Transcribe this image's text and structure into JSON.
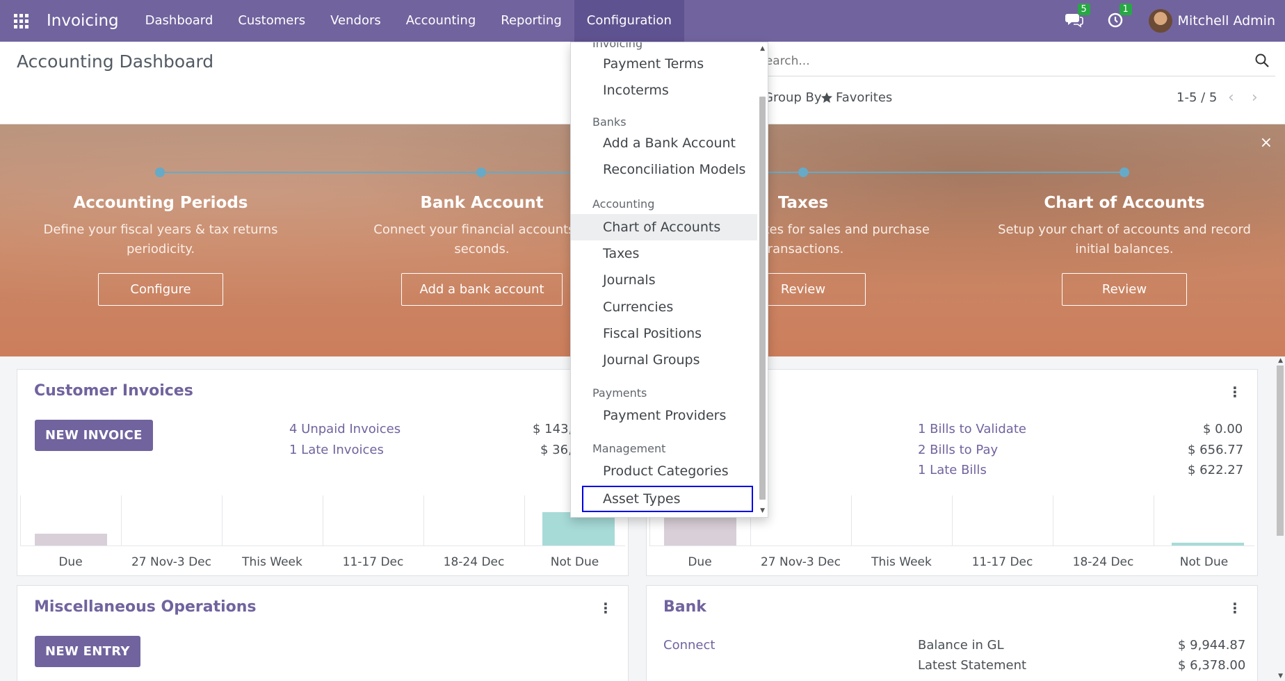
{
  "navbar": {
    "brand": "Invoicing",
    "menu": [
      "Dashboard",
      "Customers",
      "Vendors",
      "Accounting",
      "Reporting",
      "Configuration"
    ],
    "messages_count": "5",
    "activities_count": "1",
    "user_name": "Mitchell Admin"
  },
  "control_panel": {
    "title": "Accounting Dashboard",
    "search_placeholder": "Search...",
    "group_by": "Group By",
    "favorites": "Favorites",
    "pager": "1-5 / 5"
  },
  "onboarding": {
    "steps": [
      {
        "title": "Accounting Periods",
        "desc": "Define your fiscal years & tax returns periodicity.",
        "button": "Configure"
      },
      {
        "title": "Bank Account",
        "desc": "Connect your financial accounts in seconds.",
        "button": "Add a bank account"
      },
      {
        "title": "Taxes",
        "desc": "Set default Taxes for sales and purchase transactions.",
        "button": "Review"
      },
      {
        "title": "Chart of Accounts",
        "desc": "Setup your chart of accounts and record initial balances.",
        "button": "Review"
      }
    ],
    "close": "×"
  },
  "customer_invoices": {
    "title": "Customer Invoices",
    "button": "NEW INVOICE",
    "rows": [
      {
        "label": "4 Unpaid Invoices",
        "amount": "$ 143,"
      },
      {
        "label": "1 Late Invoices",
        "amount": "$ 36,"
      }
    ],
    "graph_labels": [
      "Due",
      "27 Nov-3 Dec",
      "This Week",
      "11-17 Dec",
      "18-24 Dec",
      "Not Due"
    ]
  },
  "vendor_bills": {
    "rows": [
      {
        "label": "1 Bills to Validate",
        "amount": "$ 0.00"
      },
      {
        "label": "2 Bills to Pay",
        "amount": "$ 656.77"
      },
      {
        "label": "1 Late Bills",
        "amount": "$ 622.27"
      }
    ],
    "graph_labels": [
      "Due",
      "27 Nov-3 Dec",
      "This Week",
      "11-17 Dec",
      "18-24 Dec",
      "Not Due"
    ]
  },
  "misc_operations": {
    "title": "Miscellaneous Operations",
    "button": "NEW ENTRY"
  },
  "bank": {
    "title": "Bank",
    "connect": "Connect",
    "rows": [
      {
        "label": "Balance in GL",
        "amount": "$ 9,944.87"
      },
      {
        "label": "Latest Statement",
        "amount": "$ 6,378.00"
      }
    ]
  },
  "config_menu": {
    "partial_header": "Invoicing",
    "items_invoicing": [
      "Payment Terms",
      "Incoterms"
    ],
    "section_banks": "Banks",
    "items_banks": [
      "Add a Bank Account",
      "Reconciliation Models"
    ],
    "section_accounting": "Accounting",
    "items_accounting": [
      "Chart of Accounts",
      "Taxes",
      "Journals",
      "Currencies",
      "Fiscal Positions",
      "Journal Groups"
    ],
    "section_payments": "Payments",
    "items_payments": [
      "Payment Providers"
    ],
    "section_management": "Management",
    "items_management": [
      "Product Categories",
      "Asset Types"
    ]
  },
  "colors": {
    "brand": "#71639e",
    "focus_outline": "#0000e6",
    "due_bar": "#d9cfd8",
    "not_due_bar": "#a7dbd8"
  }
}
